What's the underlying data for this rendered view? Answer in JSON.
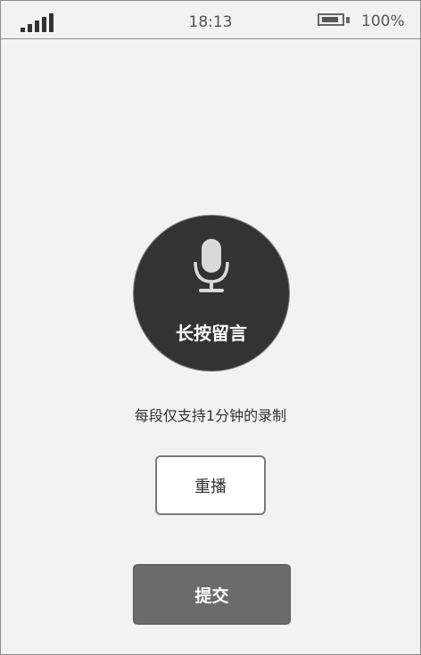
{
  "status_bar": {
    "signal_icon": "signal-bars-icon",
    "time": "18:13",
    "battery_icon": "battery-icon",
    "battery_percent": "100%"
  },
  "recorder": {
    "mic_icon": "microphone-icon",
    "button_label": "长按留言"
  },
  "hint_text": "每段仅支持1分钟的录制",
  "replay_button": {
    "label": "重播"
  },
  "submit_button": {
    "label": "提交"
  }
}
